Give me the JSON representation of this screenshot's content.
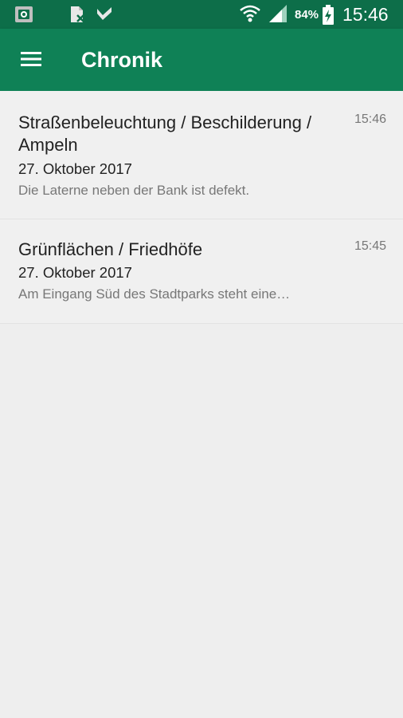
{
  "status_bar": {
    "battery_percent": "84%",
    "clock": "15:46",
    "icons": [
      "notification-app-icon",
      "doc-icon",
      "download-check-icon",
      "wifi-icon",
      "signal-icon",
      "battery-charging-icon"
    ]
  },
  "app_bar": {
    "title": "Chronik",
    "menu_icon": "hamburger-menu-icon"
  },
  "colors": {
    "status_bar_bg": "#0d6e49",
    "app_bar_bg": "#0f8156",
    "background": "#eeeeee"
  },
  "items": [
    {
      "title": "Straßenbeleuchtung / Beschilderung / Ampeln",
      "date": "27. Oktober 2017",
      "description": "Die Laterne neben der Bank ist defekt.",
      "time": "15:46"
    },
    {
      "title": "Grünflächen / Friedhöfe",
      "date": "27. Oktober 2017",
      "description": "Am Eingang Süd des Stadtparks steht eine…",
      "time": "15:45"
    }
  ]
}
